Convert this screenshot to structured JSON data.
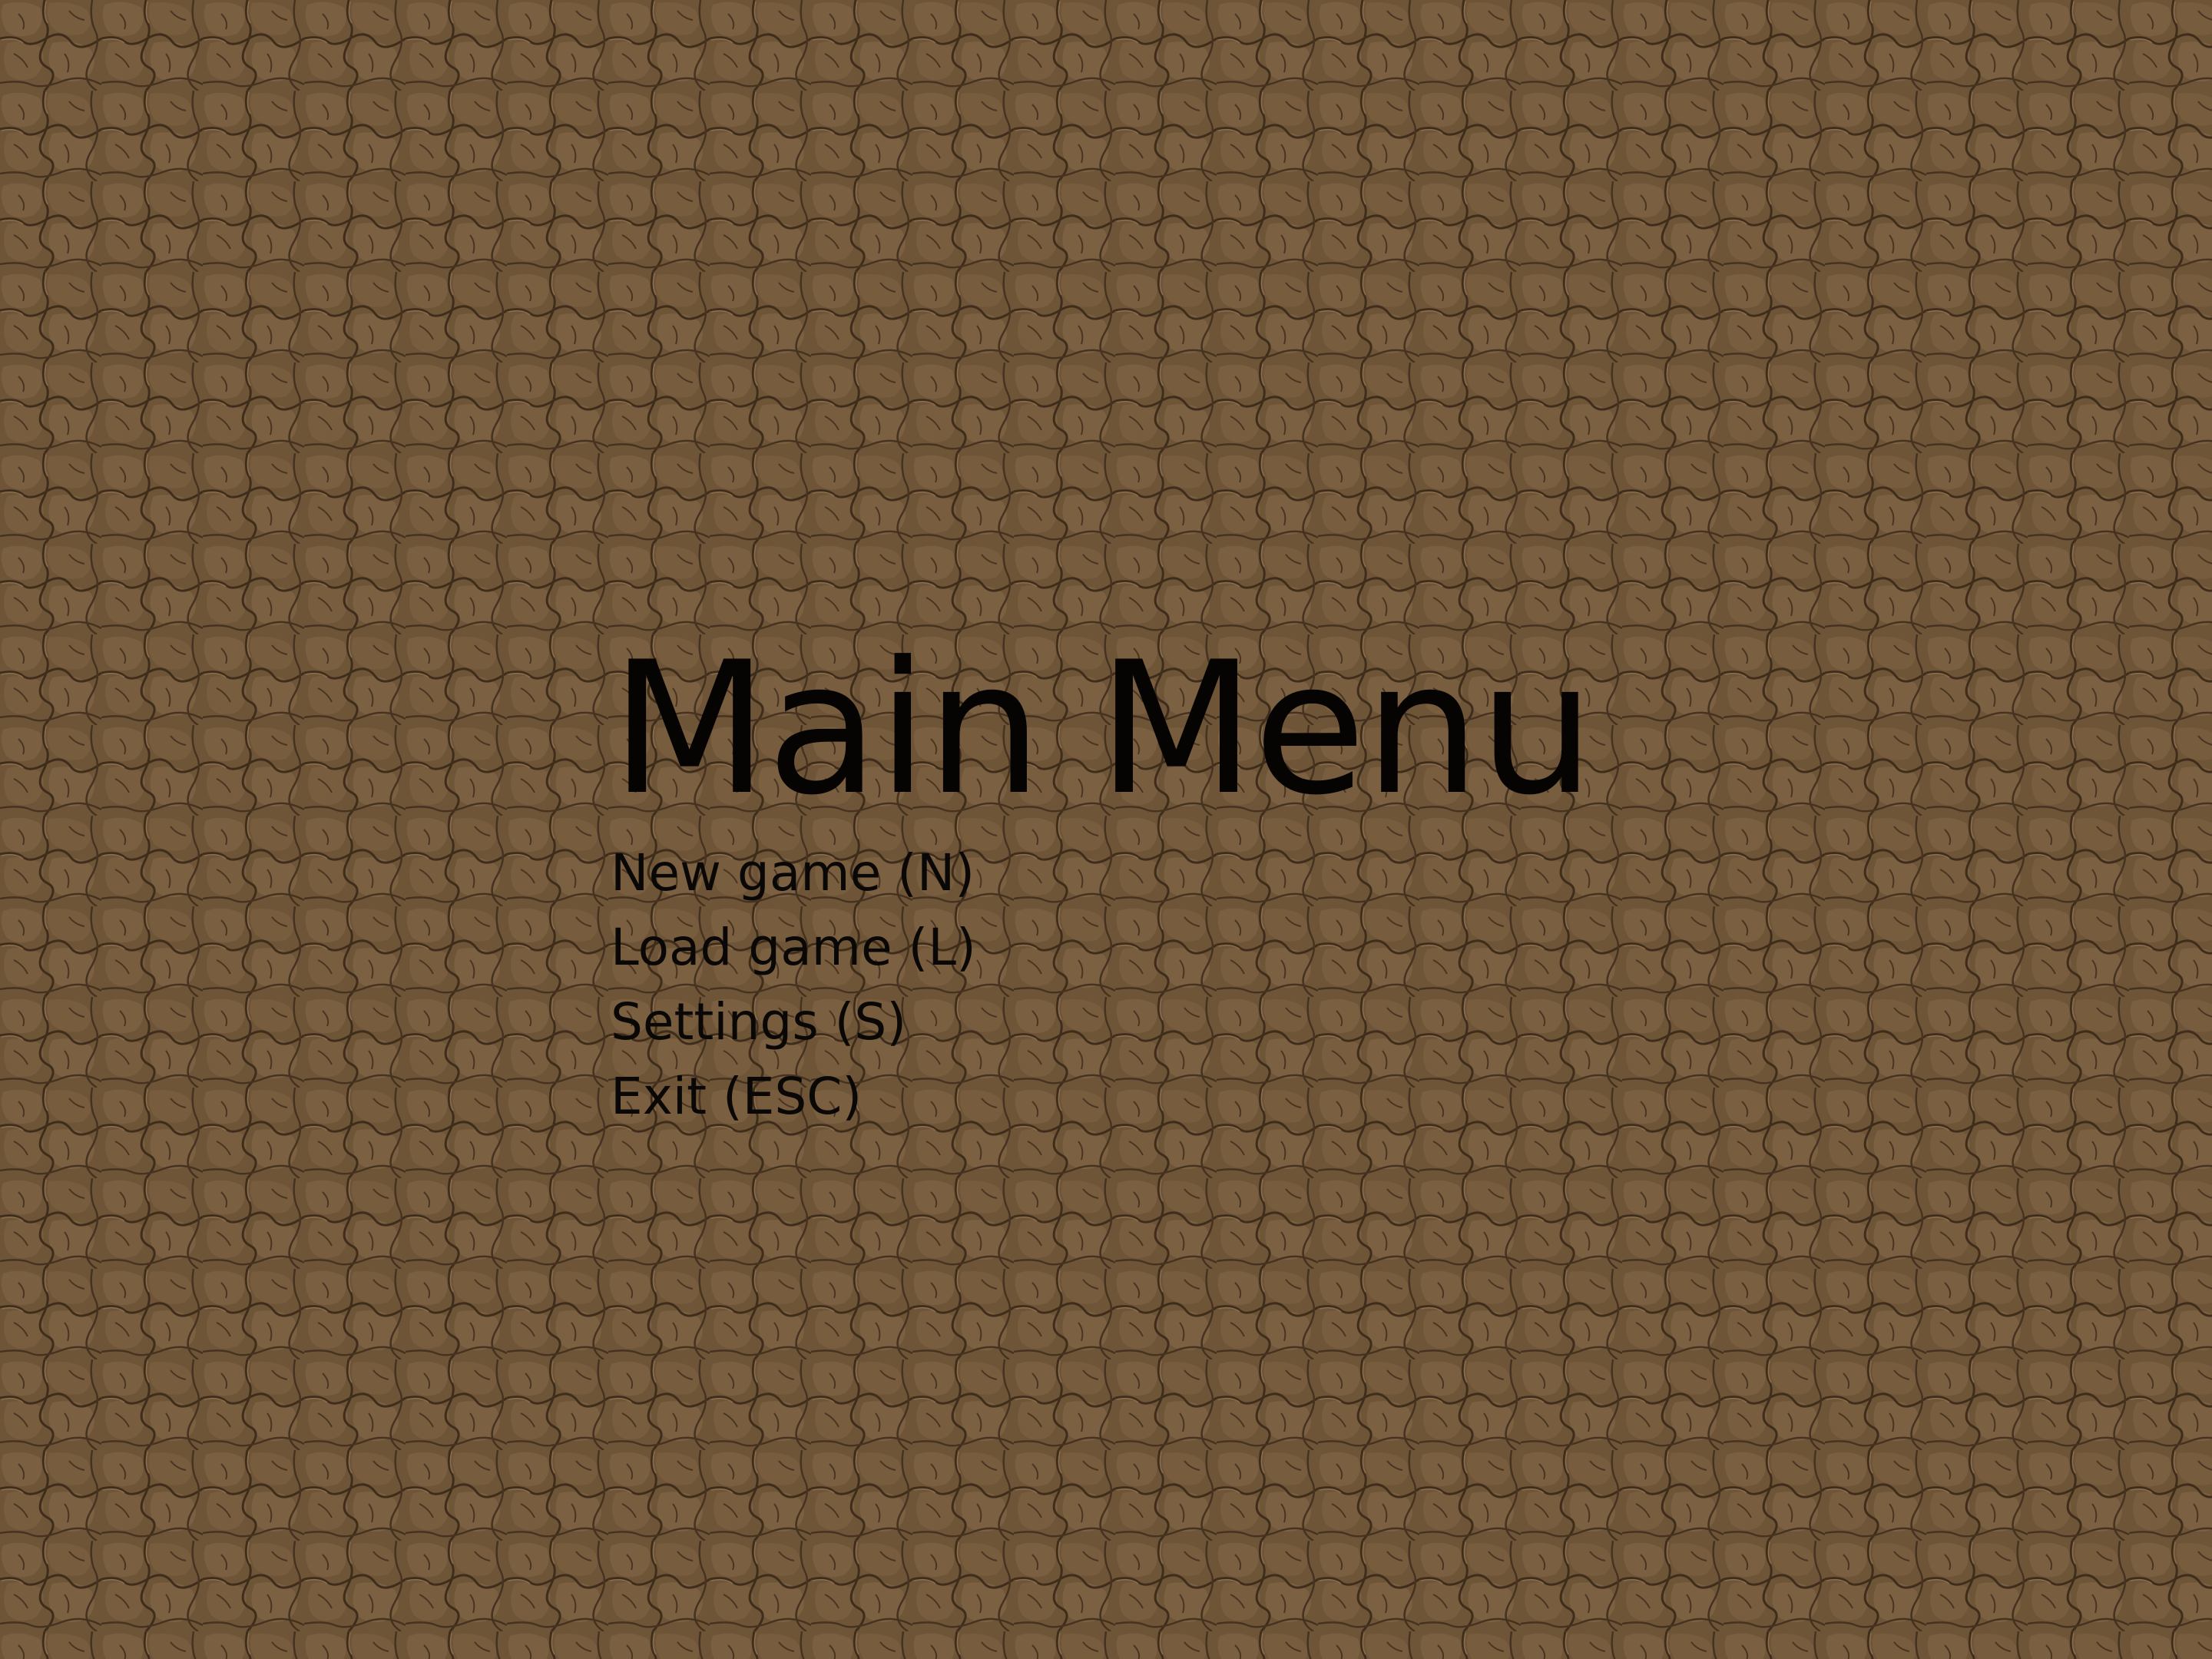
{
  "background": {
    "texture": "cracked-earth",
    "base_color": "#6e5437"
  },
  "menu": {
    "title": "Main Menu",
    "items": [
      {
        "label": "New game (N)"
      },
      {
        "label": "Load game (L)"
      },
      {
        "label": "Settings (S)"
      },
      {
        "label": "Exit (ESC)"
      }
    ]
  }
}
